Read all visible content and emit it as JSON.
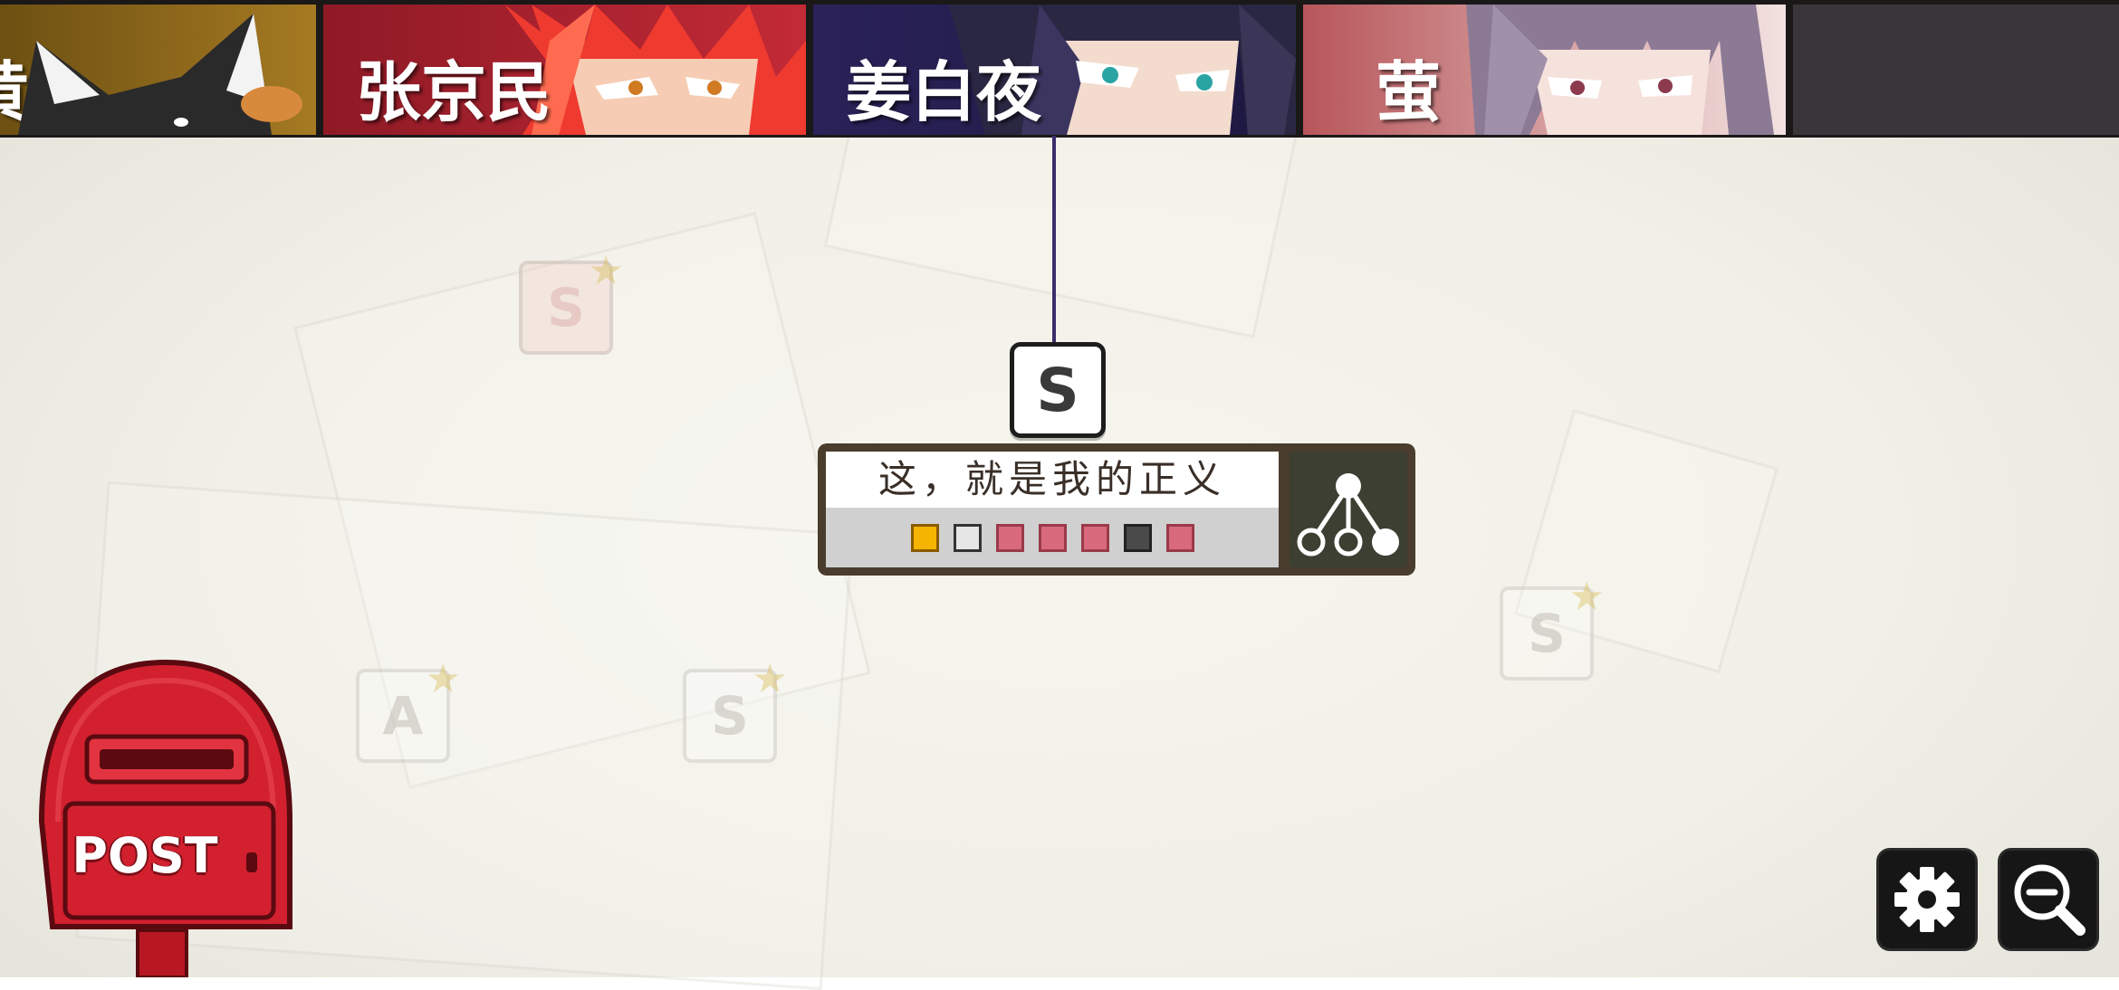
{
  "tabs": [
    {
      "label": "黄",
      "bg": "#7a5a14"
    },
    {
      "label": "张京民",
      "bg": "#a7202c"
    },
    {
      "label": "姜白夜",
      "bg": "#2d2360"
    },
    {
      "label": "萤",
      "bg": "#8f3a3e"
    },
    {
      "label": "",
      "bg": "#3a3539"
    }
  ],
  "story": {
    "rank": "S",
    "title": "这，就是我的正义",
    "markers": [
      {
        "color": "#f4b400",
        "border": "#8a5a00"
      },
      {
        "color": "#e6e6e6",
        "border": "#333333"
      },
      {
        "color": "#d96a7e",
        "border": "#9a3a49"
      },
      {
        "color": "#d96a7e",
        "border": "#9a3a49"
      },
      {
        "color": "#d96a7e",
        "border": "#9a3a49"
      },
      {
        "color": "#4a4a4a",
        "border": "#222222"
      },
      {
        "color": "#d96a7e",
        "border": "#9a3a49"
      }
    ]
  },
  "ghost_tiles": [
    {
      "grade": "S",
      "style": "pink"
    },
    {
      "grade": "A",
      "style": "plain"
    },
    {
      "grade": "S",
      "style": "plain"
    },
    {
      "grade": "S",
      "style": "plain"
    }
  ],
  "postbox": {
    "label": "POST"
  },
  "icons": {
    "settings": "gear-icon",
    "zoom": "zoom-out-icon",
    "branch": "branch-tree-icon"
  },
  "colors": {
    "line": "#3b2d6b",
    "card_frame": "#4a3d2e",
    "postbox_red": "#d2202f"
  }
}
